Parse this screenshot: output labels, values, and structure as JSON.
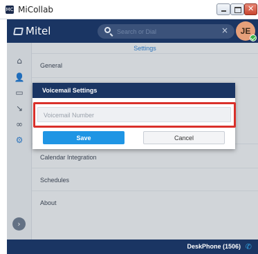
{
  "window": {
    "app_icon_text": "MC",
    "title": "MiCollab"
  },
  "header": {
    "logo": "Mitel",
    "search_placeholder": "Search or Dial",
    "search_clear_icon": "×",
    "avatar_initials": "JE",
    "presence_status": "available",
    "brand_color": "#1a3563"
  },
  "rail": {
    "icons": [
      {
        "name": "home-icon",
        "glyph": "⌂"
      },
      {
        "name": "contacts-icon",
        "glyph": "👤"
      },
      {
        "name": "chat-icon",
        "glyph": "▭"
      },
      {
        "name": "calls-icon",
        "glyph": "↘"
      },
      {
        "name": "voicemail-icon",
        "glyph": "∞"
      },
      {
        "name": "settings-icon",
        "glyph": "⚙"
      }
    ],
    "expand_icon": "›"
  },
  "settings": {
    "title": "Settings",
    "items": [
      "General",
      "Calendar Integration",
      "Schedules",
      "About"
    ]
  },
  "modal": {
    "title": "Voicemail Settings",
    "voicemail_placeholder": "Voicemail Number",
    "voicemail_value": "",
    "save_label": "Save",
    "cancel_label": "Cancel",
    "accent_color": "#1f95e4",
    "highlight_color": "#d9302a"
  },
  "footer": {
    "device": "DeskPhone (1506)",
    "phone_icon": "✆"
  }
}
